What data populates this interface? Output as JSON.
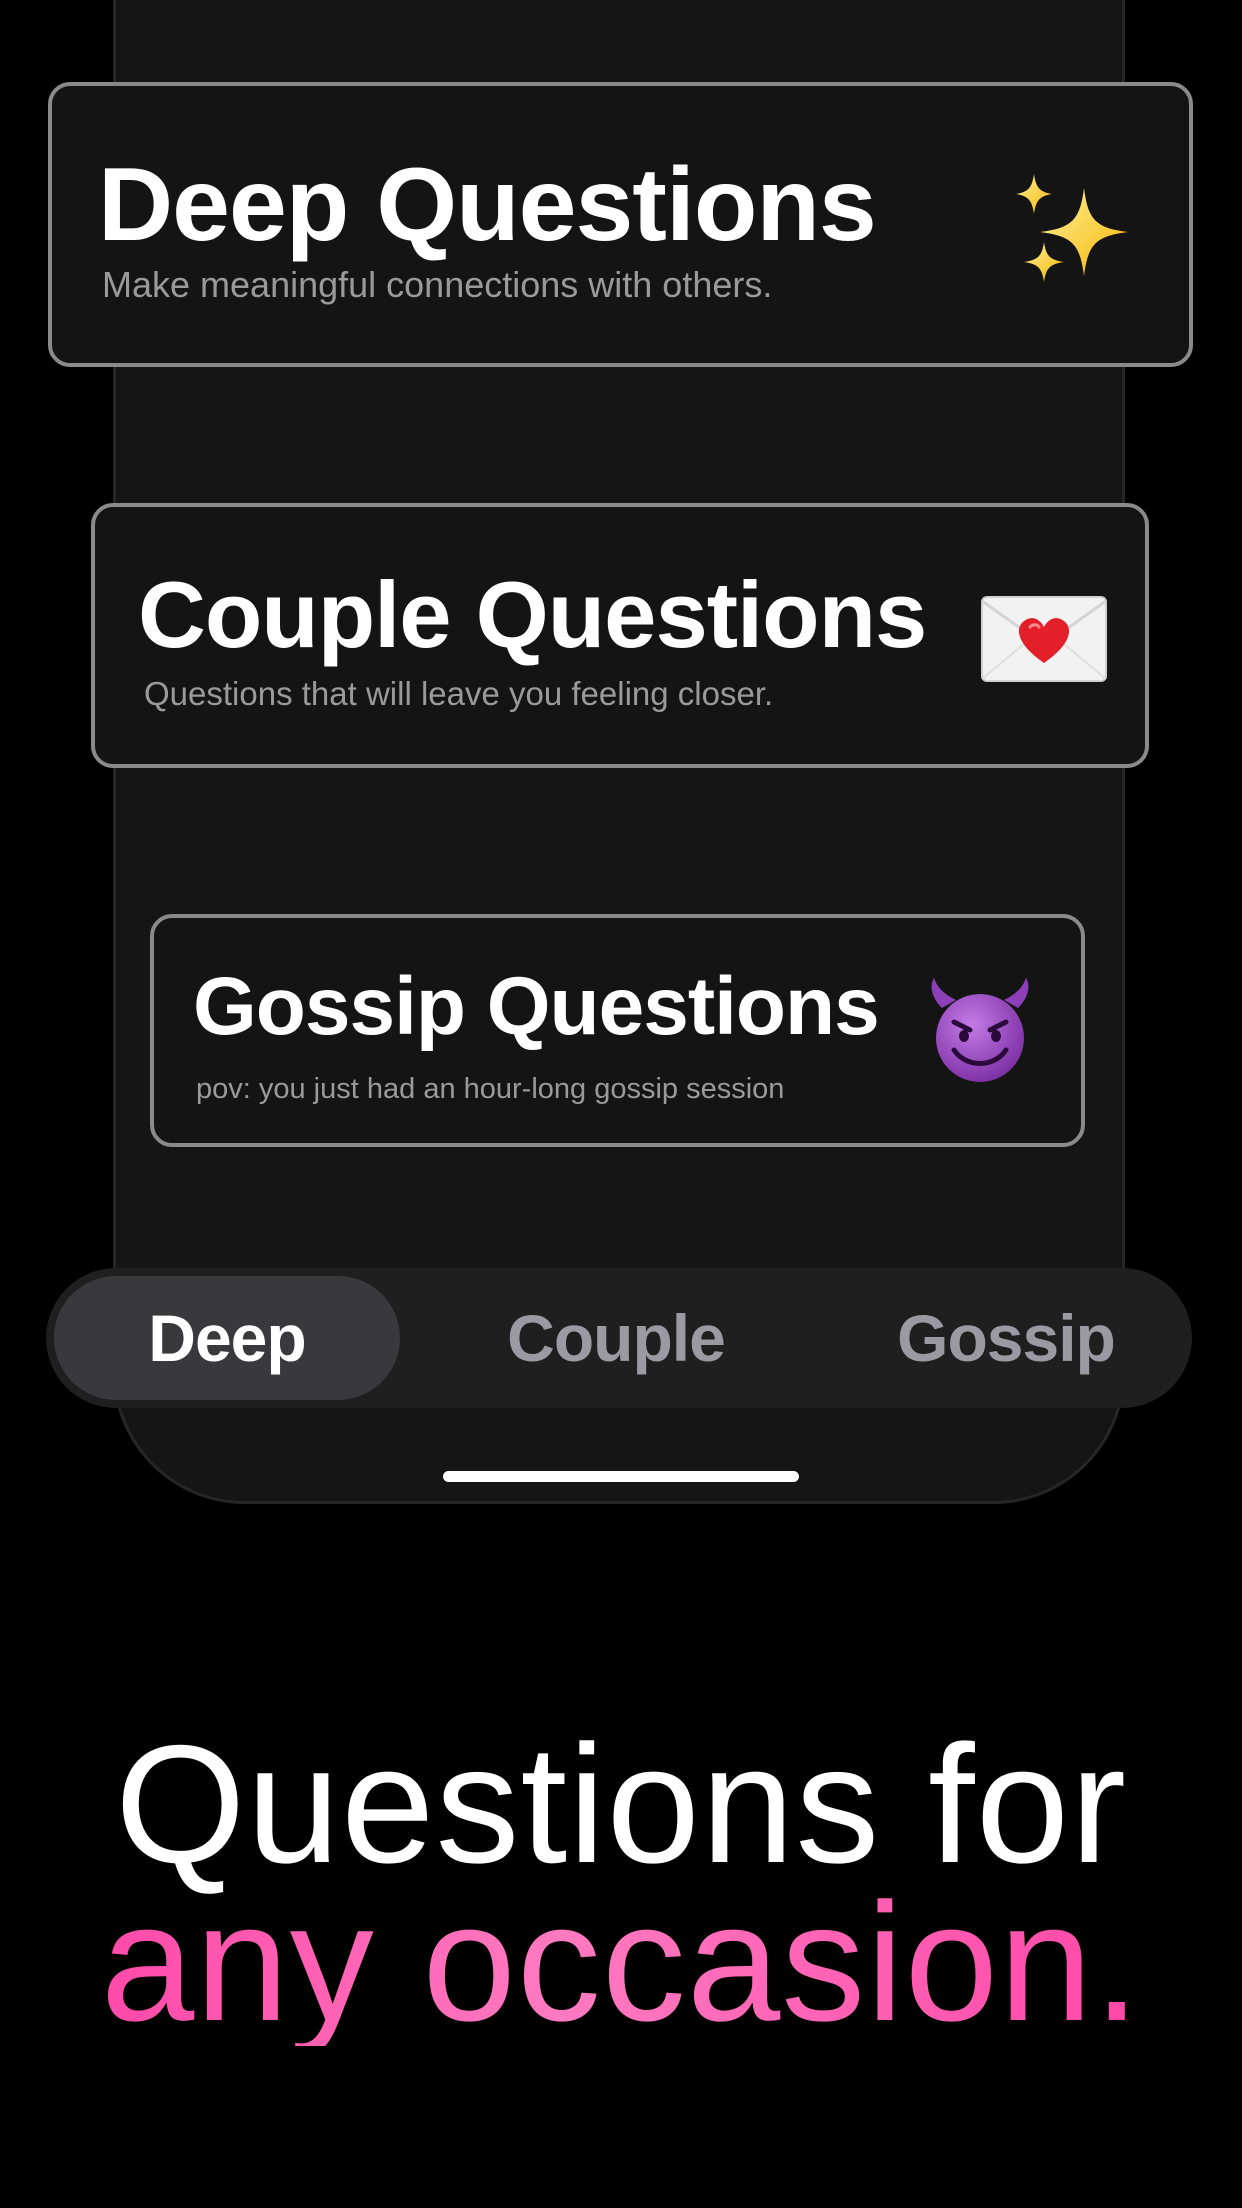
{
  "cards": {
    "deep": {
      "title": "Deep Questions",
      "subtitle": "Make meaningful connections with others.",
      "icon": "sparkles-icon"
    },
    "couple": {
      "title": "Couple Questions",
      "subtitle": "Questions that will leave you feeling closer.",
      "icon": "love-letter-icon"
    },
    "gossip": {
      "title": "Gossip Questions",
      "subtitle": "pov: you just had an hour-long gossip session",
      "icon": "smiling-devil-icon"
    }
  },
  "tabs": [
    {
      "label": "Deep",
      "active": true
    },
    {
      "label": "Couple",
      "active": false
    },
    {
      "label": "Gossip",
      "active": false
    }
  ],
  "headline": {
    "line1": "Questions for",
    "line2": "any occasion."
  },
  "colors": {
    "background": "#000000",
    "card_border": "#8a8a8a",
    "accent_pink": "#ff3fa4",
    "tab_active_bg": "#38383d",
    "tab_inactive_text": "#9b9aa2"
  }
}
